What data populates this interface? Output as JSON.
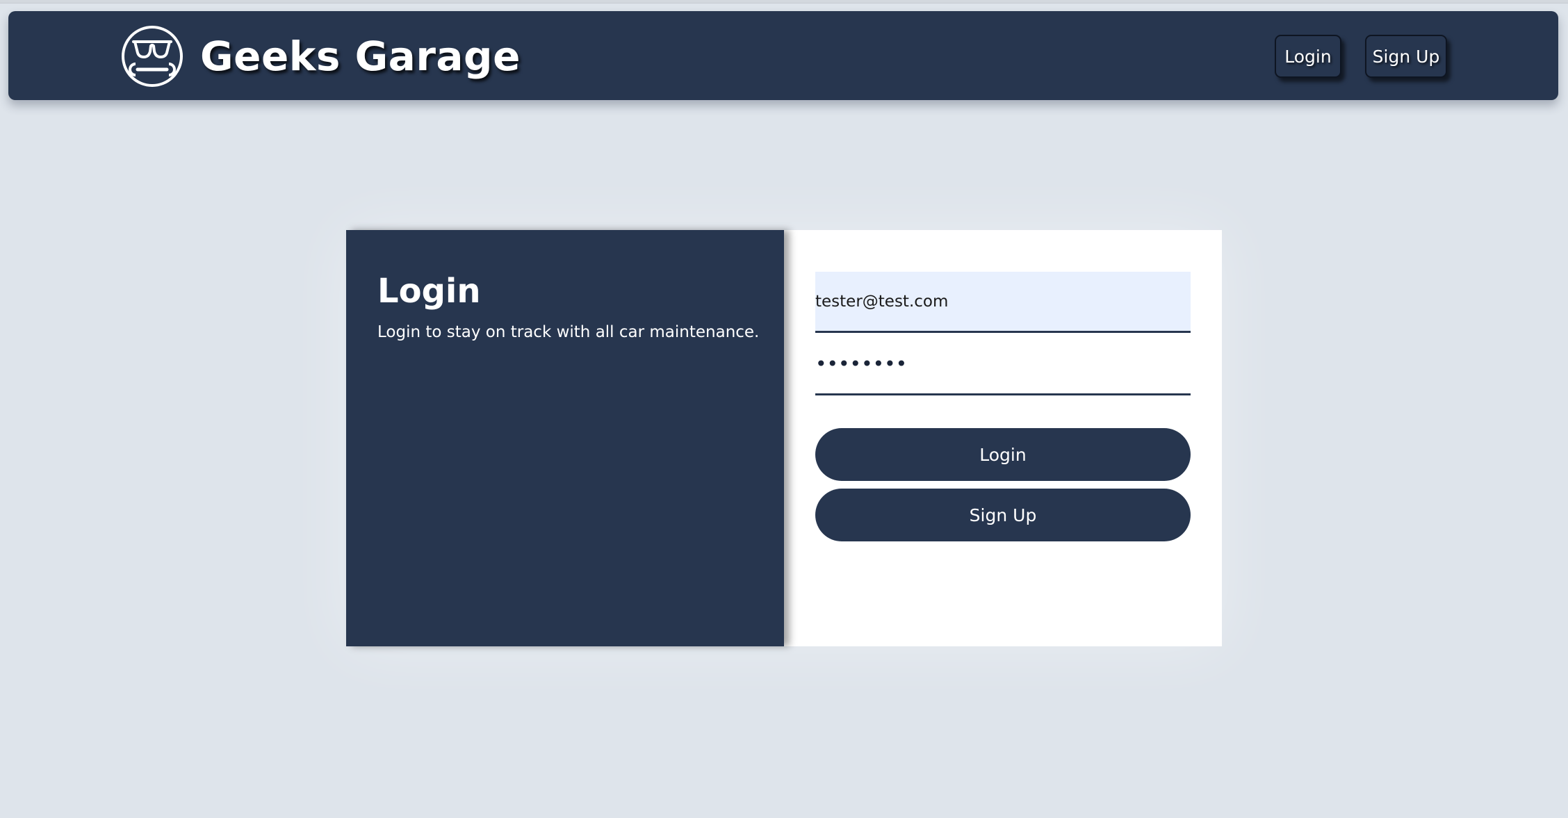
{
  "brand": {
    "name": "Geeks Garage",
    "logo_icon": "nerd-glasses-wrench-logo"
  },
  "nav": {
    "login_label": "Login",
    "signup_label": "Sign Up"
  },
  "login_panel": {
    "title": "Login",
    "subtitle": "Login to stay on track with all car maintenance."
  },
  "form": {
    "email_value": "tester@test.com",
    "password_value": "••••••••",
    "login_button": "Login",
    "signup_button": "Sign Up"
  },
  "colors": {
    "primary": "#27364f",
    "background": "#dee4eb",
    "autofill": "#e8f0fe",
    "white": "#ffffff"
  }
}
